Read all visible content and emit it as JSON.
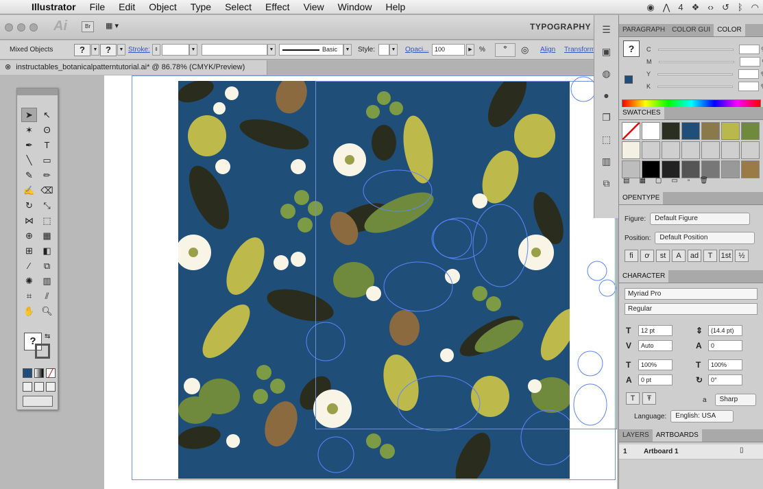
{
  "menubar": {
    "app_name": "Illustrator",
    "items": [
      "File",
      "Edit",
      "Object",
      "Type",
      "Select",
      "Effect",
      "View",
      "Window",
      "Help"
    ],
    "status_count": "4"
  },
  "appbar": {
    "bridge_label": "Br",
    "workspace": "TYPOGRAPHY"
  },
  "controlbar": {
    "selection": "Mixed Objects",
    "stroke_label": "Stroke:",
    "brush_label": "Basic",
    "style_label": "Style:",
    "opacity_label": "Opaci...",
    "opacity_value": "100",
    "percent": "%",
    "align_label": "Align",
    "transform_label": "Transform"
  },
  "document": {
    "tab_title": "instructables_botanicalpatterntutorial.ai* @ 86.78% (CMYK/Preview)"
  },
  "color_panel": {
    "tabs": [
      "PARAGRAPH",
      "COLOR GUI",
      "COLOR"
    ],
    "channels": [
      "C",
      "M",
      "Y",
      "K"
    ],
    "unit": "%"
  },
  "swatches_panel": {
    "title": "SWATCHES",
    "colors": [
      "#ffffff",
      "#ffffff",
      "#2b2f22",
      "#1f4e79",
      "#8a7a4a",
      "#b9b84c",
      "#6f8a3c",
      "#f4f1e4",
      "#cfcfcf",
      "#cfcfcf",
      "#cfcfcf",
      "#cfcfcf",
      "#cfcfcf",
      "#cfcfcf",
      "#bdbdbd",
      "#000000",
      "#222222",
      "#555555",
      "#777777",
      "#999999",
      "#9a7a45"
    ]
  },
  "opentype_panel": {
    "title": "OPENTYPE",
    "figure_label": "Figure:",
    "figure_value": "Default Figure",
    "position_label": "Position:",
    "position_value": "Default Position",
    "buttons": [
      "fi",
      "ơ",
      "st",
      "A",
      "ad",
      "T",
      "1st",
      "½"
    ]
  },
  "character_panel": {
    "title": "CHARACTER",
    "font": "Myriad Pro",
    "style": "Regular",
    "size": "12 pt",
    "leading": "(14.4 pt)",
    "kerning": "Auto",
    "tracking": "0",
    "vscale": "100%",
    "hscale": "100%",
    "baseline": "0 pt",
    "rotation": "0°",
    "aa_label": "a",
    "antialias": "Sharp",
    "language_label": "Language:",
    "language": "English: USA"
  },
  "layers_panel": {
    "tabs": [
      "LAYERS",
      "ARTBOARDS"
    ],
    "rows": [
      {
        "num": "1",
        "name": "Artboard 1"
      }
    ]
  },
  "colors": {
    "artboard": "#1f4e79",
    "leaf_dark": "#2a2d1e",
    "leaf_olive": "#6f8a3c",
    "leaf_yellow": "#bdb94a",
    "leaf_brown": "#8a6a3e",
    "flower_white": "#f8f5e6",
    "outline_blue": "#4a7adf"
  }
}
